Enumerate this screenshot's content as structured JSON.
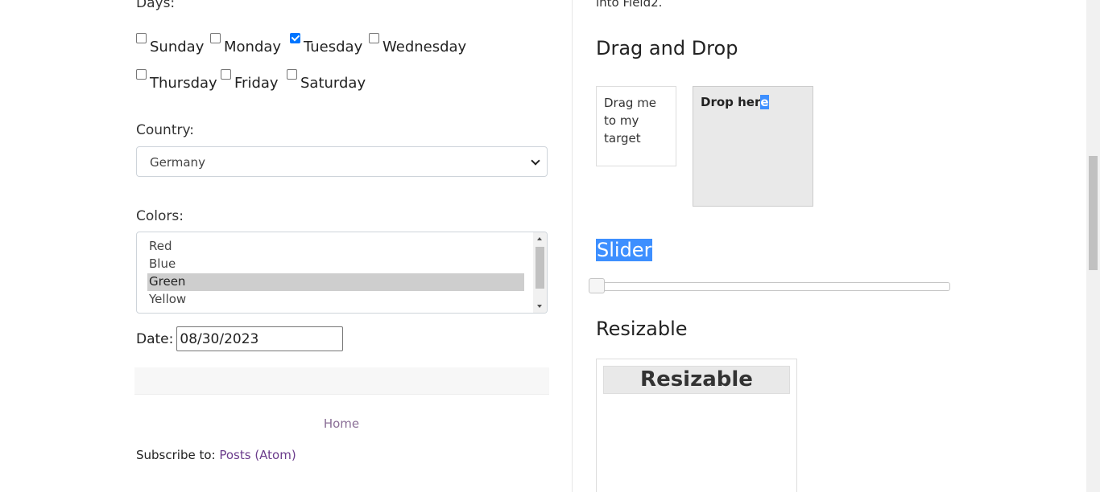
{
  "left": {
    "days_label": "Days:",
    "days": [
      {
        "label": "Sunday",
        "checked": false
      },
      {
        "label": "Monday",
        "checked": false
      },
      {
        "label": "Tuesday",
        "checked": true
      },
      {
        "label": "Wednesday",
        "checked": false
      },
      {
        "label": "Thursday",
        "checked": false
      },
      {
        "label": "Friday",
        "checked": false
      },
      {
        "label": "Saturday",
        "checked": false
      }
    ],
    "country_label": "Country:",
    "country_value": "Germany",
    "colors_label": "Colors:",
    "colors": [
      {
        "label": "Red",
        "selected": false
      },
      {
        "label": "Blue",
        "selected": false
      },
      {
        "label": "Green",
        "selected": true
      },
      {
        "label": "Yellow",
        "selected": false
      }
    ],
    "date_label": "Date:",
    "date_value": "08/30/2023",
    "home_link": "Home",
    "subscribe_prefix": "Subscribe to: ",
    "subscribe_link": "Posts (Atom)"
  },
  "right": {
    "top_clip": "into Field2.",
    "drag_drop_title": "Drag and Drop",
    "drag_text": "Drag me to my target",
    "drop_text_a": "Drop her",
    "drop_text_b": "e",
    "slider_title": "Slider",
    "slider_value": 0,
    "resizable_title": "Resizable",
    "resizable_header": "Resizable"
  },
  "colors": {
    "accent": "#0075ff",
    "selection": "#3d8fff",
    "link_purple": "#6b3c8c"
  }
}
